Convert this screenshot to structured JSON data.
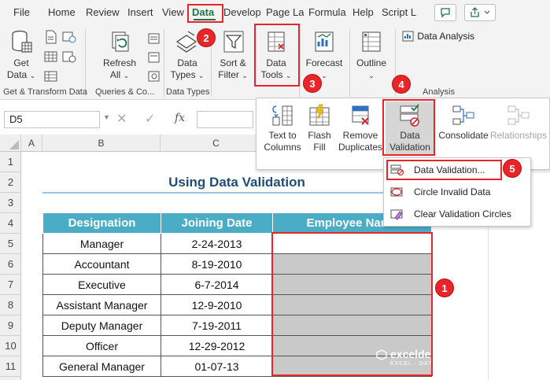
{
  "menu": {
    "tabs": [
      "File",
      "Home",
      "Review",
      "Insert",
      "View",
      "Data",
      "Develop",
      "Page La",
      "Formula",
      "Help",
      "Script L"
    ],
    "active_tab": "Data"
  },
  "ribbon": {
    "get_data_line1": "Get",
    "get_data_line2": "Data",
    "refresh_line1": "Refresh",
    "refresh_line2": "All",
    "data_types_line1": "Data",
    "data_types_line2": "Types",
    "sort_filter_line1": "Sort &",
    "sort_filter_line2": "Filter",
    "data_tools_line1": "Data",
    "data_tools_line2": "Tools",
    "forecast_label": "Forecast",
    "outline_label": "Outline",
    "data_analysis_label": "Data Analysis",
    "group_labels": [
      "Get & Transform Data",
      "Queries & Co...",
      "Data Types",
      "Analysis"
    ]
  },
  "data_tools_panel": {
    "text_to_columns_line1": "Text to",
    "text_to_columns_line2": "Columns",
    "flash_fill_line1": "Flash",
    "flash_fill_line2": "Fill",
    "remove_dup_line1": "Remove",
    "remove_dup_line2": "Duplicates",
    "data_validation_line1": "Data",
    "data_validation_line2": "Validation",
    "consolidate_label": "Consolidate",
    "relationships_label": "Relationships"
  },
  "validation_menu": {
    "items": [
      "Data Validation...",
      "Circle Invalid Data",
      "Clear Validation Circles"
    ]
  },
  "formula_bar": {
    "name_box": "D5",
    "fx": "fx"
  },
  "grid": {
    "columns": [
      "A",
      "B",
      "C"
    ],
    "rows": [
      "1",
      "2",
      "3",
      "4",
      "5",
      "6",
      "7",
      "8",
      "9",
      "10",
      "11"
    ]
  },
  "sheet": {
    "title": "Using Data Validation",
    "headers": [
      "Designation",
      "Joining Date",
      "Employee Name"
    ],
    "rows": [
      [
        "Manager",
        "2-24-2013"
      ],
      [
        "Accountant",
        "8-19-2010"
      ],
      [
        "Executive",
        "6-7-2014"
      ],
      [
        "Assistant Manager",
        "12-9-2010"
      ],
      [
        "Deputy Manager",
        "7-19-2011"
      ],
      [
        "Officer",
        "12-29-2012"
      ],
      [
        "General Manager",
        "01-07-13"
      ]
    ]
  },
  "callouts": [
    "1",
    "2",
    "3",
    "4",
    "5"
  ],
  "watermark": {
    "brand": "exceldemy",
    "tagline": "EXCEL · DATA · BI"
  },
  "colors": {
    "accent": "#217346",
    "header_fill": "#4bacc6",
    "title_text": "#1f4e79",
    "callout_red": "#e8262a",
    "empty_cell": "#c9c9c9"
  }
}
